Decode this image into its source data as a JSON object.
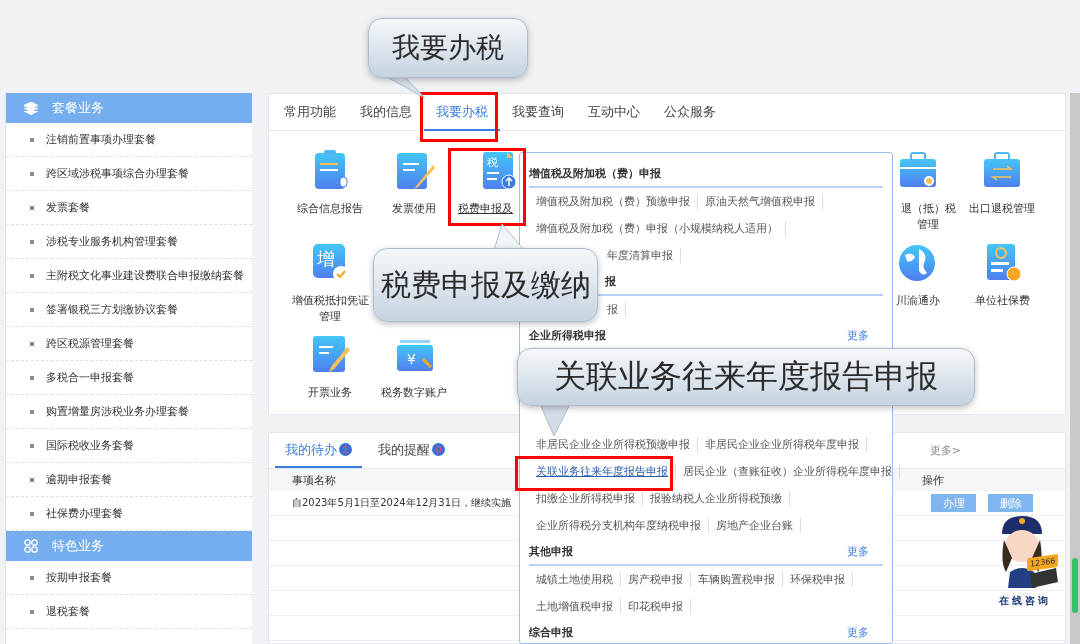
{
  "sidebar": {
    "groups": [
      {
        "title": "套餐业务",
        "items": [
          "注销前置事项办理套餐",
          "跨区域涉税事项综合办理套餐",
          "发票套餐",
          "涉税专业服务机构管理套餐",
          "主附税文化事业建设费联合申报缴纳套餐",
          "签署银税三方划缴协议套餐",
          "跨区税源管理套餐",
          "多税合一申报套餐",
          "购置增量房涉税业务办理套餐",
          "国际税收业务套餐",
          "逾期申报套餐",
          "社保费办理套餐"
        ]
      },
      {
        "title": "特色业务",
        "items": [
          "按期申报套餐",
          "退税套餐"
        ]
      }
    ]
  },
  "main_tabs": [
    {
      "label": "常用功能",
      "selected": false
    },
    {
      "label": "我的信息",
      "selected": false
    },
    {
      "label": "我要办税",
      "selected": true
    },
    {
      "label": "我要查询",
      "selected": false
    },
    {
      "label": "互动中心",
      "selected": false
    },
    {
      "label": "公众服务",
      "selected": false
    }
  ],
  "services": [
    [
      {
        "kind": "app",
        "label": "综合信息报告"
      },
      {
        "kind": "app",
        "label": "发票使用"
      },
      {
        "kind": "clipped",
        "label": "税费申报及",
        "icon_text": "税",
        "hovered": true
      },
      {
        "kind": "blank"
      },
      {
        "kind": "blank"
      },
      {
        "kind": "blank"
      },
      {
        "kind": "blank"
      },
      {
        "kind": "narrow",
        "label": "退（抵）税管理"
      },
      {
        "kind": "app",
        "label": "出口退税管理"
      }
    ],
    [
      {
        "kind": "app",
        "label": "增值税抵扣凭证管理",
        "icon_text": "增"
      },
      {
        "kind": "blank"
      },
      {
        "kind": "blank"
      },
      {
        "kind": "blank"
      },
      {
        "kind": "blank"
      },
      {
        "kind": "blank"
      },
      {
        "kind": "blank"
      },
      {
        "kind": "app",
        "label": "川渝通办"
      },
      {
        "kind": "app",
        "label": "单位社保费"
      }
    ],
    [
      {
        "kind": "app",
        "label": "开票业务"
      },
      {
        "kind": "app",
        "label": "税务数字账户",
        "icon_text": "¥"
      }
    ]
  ],
  "dropdown": {
    "sections": [
      {
        "title": "增值税及附加税（费）申报",
        "kind": "full",
        "rows": [
          [
            {
              "text": "增值税及附加税（费）预缴申报",
              "kind": "plain"
            },
            {
              "text": "原油天然气增值税申报",
              "kind": "plain"
            }
          ],
          [
            {
              "text": "增值税及附加税（费）申报（小规模纳税人适用）",
              "kind": "plain"
            }
          ],
          [
            {
              "text": "年度清算申报",
              "kind": "partial"
            }
          ]
        ]
      },
      {
        "title": "报",
        "kind": "cut",
        "rows": [
          [
            {
              "text": "报",
              "kind": "partial"
            }
          ]
        ]
      },
      {
        "title": "企业所得税申报",
        "more": "更多",
        "kind": "covered",
        "rows": [
          [
            {
              "text": "非居民企业企业所得税预缴申报",
              "kind": "plain"
            },
            {
              "text": "非居民企业企业所得税年度申报",
              "kind": "plain"
            }
          ],
          [
            {
              "text": "关联业务往来年度报告申报",
              "kind": "link"
            },
            {
              "text": "居民企业（查账征收）企业所得税年度申报",
              "kind": "plain"
            }
          ],
          [
            {
              "text": "扣缴企业所得税申报",
              "kind": "plain"
            },
            {
              "text": "报验纳税人企业所得税预缴",
              "kind": "plain"
            }
          ],
          [
            {
              "text": "企业所得税分支机构年度纳税申报",
              "kind": "plain"
            },
            {
              "text": "房地产企业台账",
              "kind": "plain"
            }
          ]
        ]
      },
      {
        "title": "其他申报",
        "more": "更多",
        "kind": "full",
        "rows": [
          [
            {
              "text": "城镇土地使用税",
              "kind": "plain"
            },
            {
              "text": "房产税申报",
              "kind": "plain"
            },
            {
              "text": "车辆购置税申报",
              "kind": "plain"
            },
            {
              "text": "环保税申报",
              "kind": "plain"
            }
          ],
          [
            {
              "text": "土地增值税申报",
              "kind": "plain"
            },
            {
              "text": "印花税申报",
              "kind": "plain"
            }
          ]
        ]
      },
      {
        "title": "综合申报",
        "more": "更多",
        "kind": "full"
      }
    ]
  },
  "todo": {
    "tabs": [
      {
        "label": "我的待办",
        "badge": "1",
        "selected": true
      },
      {
        "label": "我的提醒",
        "badge": "0",
        "selected": false
      }
    ],
    "more": "更多>",
    "columns": [
      "事项名称",
      "操作"
    ],
    "rows": [
      {
        "title": "自2023年5月1日至2024年12月31日，继续实施",
        "actions": [
          "办理",
          "删除"
        ]
      }
    ]
  },
  "assistant": {
    "screen_text": "12366",
    "label": "在线咨询"
  },
  "callouts": [
    "我要办税",
    "税费申报及缴纳",
    "关联业务往来年度报告申报"
  ]
}
